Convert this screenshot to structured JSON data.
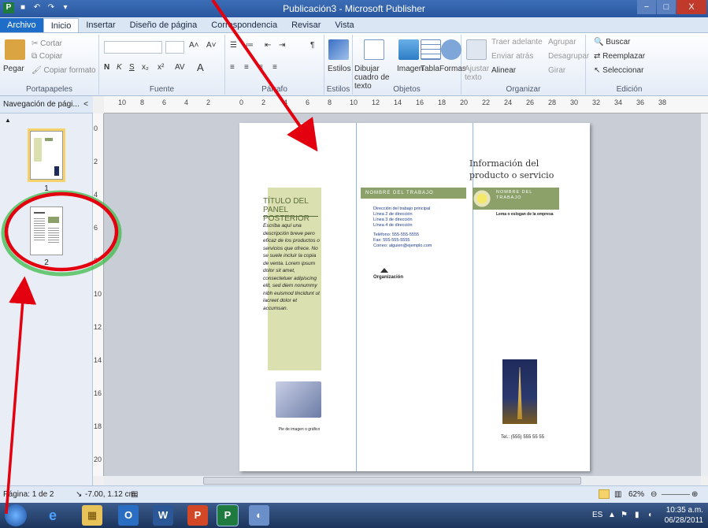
{
  "titlebar": {
    "title": "Publicación3 - Microsoft Publisher",
    "app_icon": "P",
    "minimize": "−",
    "restore": "□",
    "close": "X"
  },
  "tabs": [
    "Archivo",
    "Inicio",
    "Insertar",
    "Diseño de página",
    "Correspondencia",
    "Revisar",
    "Vista"
  ],
  "ribbon": {
    "portapapeles": {
      "name": "Portapapeles",
      "paste": "Pegar",
      "cut": "Cortar",
      "copy": "Copiar",
      "format_painter": "Copiar formato"
    },
    "fuente": {
      "name": "Fuente",
      "bold": "N",
      "italic": "K",
      "underline": "S",
      "subscript": "x₂",
      "superscript": "x²",
      "grow": "A˄",
      "shrink": "A˅",
      "spacing": "AV"
    },
    "parrafo": {
      "name": "Párrafo"
    },
    "estilos": {
      "name": "Estilos",
      "label": "Estilos"
    },
    "objetos": {
      "name": "Objetos",
      "textbox": "Dibujar cuadro de texto",
      "picture": "Imagen",
      "table": "Tabla",
      "shapes": "Formas"
    },
    "organizar": {
      "name": "Organizar",
      "wrap": "Ajustar texto",
      "bring_forward": "Traer adelante",
      "send_backward": "Enviar atrás",
      "align": "Alinear",
      "group": "Agrupar",
      "ungroup": "Desagrupar",
      "rotate": "Girar"
    },
    "edicion": {
      "name": "Edición",
      "find": "Buscar",
      "replace": "Reemplazar",
      "select": "Seleccionar"
    }
  },
  "nav": {
    "title": "Navegación de pági...",
    "collapse": "<",
    "section_marker": "▲",
    "pages": [
      {
        "label": "1",
        "selected": true
      },
      {
        "label": "2",
        "selected": false
      }
    ]
  },
  "ruler_h": [
    "10",
    "8",
    "6",
    "4",
    "2",
    "0",
    "2",
    "4",
    "6",
    "8",
    "10",
    "12",
    "14",
    "16",
    "18",
    "20",
    "22",
    "24",
    "26",
    "28",
    "30",
    "32",
    "34",
    "36",
    "38"
  ],
  "ruler_v": [
    "0",
    "2",
    "4",
    "6",
    "8",
    "10",
    "12",
    "14",
    "16",
    "18",
    "20"
  ],
  "page": {
    "panel_title": "TÍTULO DEL PANEL POSTERIOR",
    "panel_body": "Escriba aquí una descripción breve pero eficaz de los productos o servicios que ofrece. No se suele incluir la copia de venta. Lorem ipsum dolor sit amet, consectetuer adipiscing elit, sed diem nonummy nibh euismod tincidunt ut lacreet dolor et accumsan.",
    "cup_caption": "Pie de imagen o gráfico",
    "job_banner": "NOMBRE DEL TRABAJO",
    "contact_lines": [
      "Dirección del trabajo principal",
      "Línea 2 de dirección",
      "Línea 3 de dirección",
      "Línea 4 de dirección",
      "",
      "Teléfono: 555-555-5555",
      "Fax: 555-555-5555",
      "Correo: alguien@ejemplo.com"
    ],
    "org_name": "Organización",
    "product_title": "Información del producto o servicio",
    "job_banner2": "NOMBRE DEL TRABAJO",
    "slogan": "Lema o eslogan de la empresa",
    "phone": "Tel.: (555) 555 55 55"
  },
  "status": {
    "page": "Página: 1 de 2",
    "position": "-7.00, 1.12 cm.",
    "zoom": "62%"
  },
  "taskbar": {
    "apps": [
      "e",
      "▦",
      "O",
      "W",
      "P",
      "P",
      "◐"
    ],
    "lang": "ES",
    "time": "10:35 a.m.",
    "date": "06/28/2011"
  },
  "colors": {
    "accent_green": "#8ba169",
    "panel_bg": "#dbe0b0",
    "annotation_red": "#e3000f",
    "annotation_green": "#3dbb4a"
  }
}
